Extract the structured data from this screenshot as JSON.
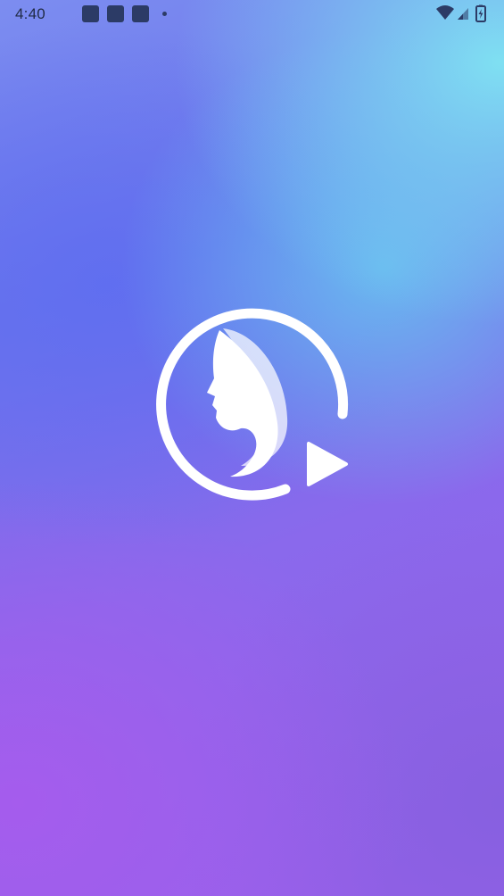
{
  "status_bar": {
    "time": "4:40",
    "notification_icons": [
      "app-notification-icon",
      "app-notification-icon",
      "app-notification-icon",
      "more-notifications-dot"
    ],
    "system_icons": [
      "wifi-icon",
      "cellular-signal-icon",
      "battery-charging-icon"
    ]
  },
  "splash": {
    "logo_icon": "woman-profile-play-logo",
    "colors": {
      "logo": "#ffffff",
      "background_top_right": "#7fe0f2",
      "background_middle": "#6b73ec",
      "background_bottom_left": "#a55ced"
    }
  }
}
